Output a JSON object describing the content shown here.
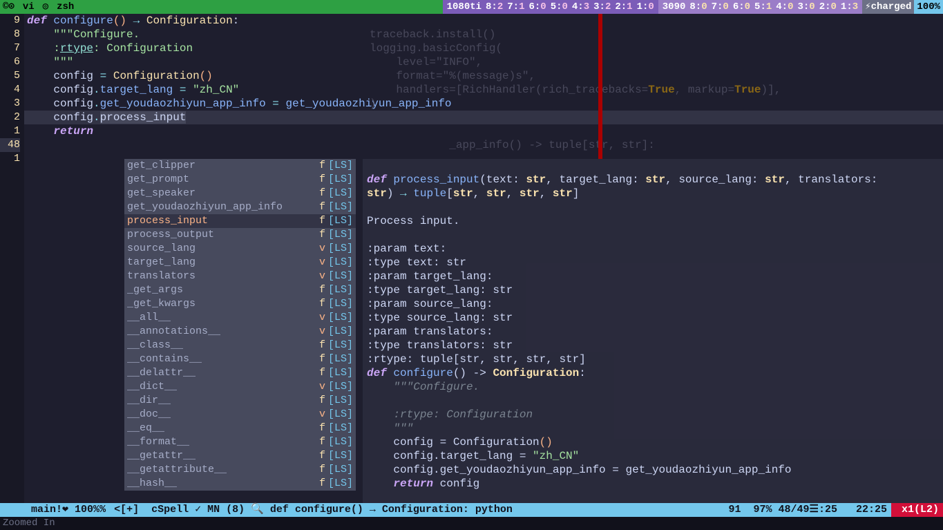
{
  "topbar": {
    "tabs": [
      "vi",
      "zsh"
    ],
    "gpu1_label": "1080ti",
    "gpu1_cores": [
      [
        "8:",
        "2"
      ],
      [
        "7:",
        "1"
      ],
      [
        "6:",
        "0"
      ],
      [
        "5:",
        "0"
      ],
      [
        "4:",
        "3"
      ],
      [
        "3:",
        "2"
      ],
      [
        "2:",
        "1"
      ],
      [
        "1:",
        "0"
      ]
    ],
    "gpu2_label": "3090",
    "gpu2_cores": [
      [
        "8:",
        "0"
      ],
      [
        "7:",
        "0"
      ],
      [
        "6:",
        "0"
      ],
      [
        "5:",
        "1"
      ],
      [
        "4:",
        "0"
      ],
      [
        "3:",
        "0"
      ],
      [
        "2:",
        "0"
      ],
      [
        "1:",
        "3"
      ]
    ],
    "charged": "charged",
    "battery": "100%"
  },
  "gutter": [
    "9",
    "8",
    "7",
    "6",
    "5",
    "4",
    "3",
    "2",
    "1",
    "48",
    "1"
  ],
  "code": {
    "l1": "",
    "l2_def": "def ",
    "l2_fn": "configure",
    "l2_par": "()",
    "l2_arrow": " → ",
    "l2_ret": "Configuration",
    "l2_colon": ":",
    "l3": "    \"\"\"Configure.",
    "l4": "",
    "l5_a": "    :",
    "l5_r": "rtype",
    "l5_b": ": Configuration",
    "l6": "    \"\"\"",
    "l7_a": "    config ",
    "l7_eq": "=",
    "l7_b": " ",
    "l7_cls": "Configuration",
    "l7_par": "()",
    "l8_a": "    config",
    "l8_dot": ".",
    "l8_attr": "target_lang",
    "l8_b": " = ",
    "l8_str": "\"zh_CN\"",
    "l9_a": "    config",
    "l9_dot": ".",
    "l9_attr": "get_youdaozhiyun_app_info",
    "l9_b": " = ",
    "l9_fn": "get_youdaozhiyun_app_info",
    "l10_a": "    config",
    "l10_dot": ".",
    "l10_attr": "process_input",
    "l11": "    return"
  },
  "bg_code": [
    "traceback.install()",
    "logging.basicConfig(",
    "    level=\"INFO\",",
    "    format=\"%(message)s\",",
    "    handlers=[RichHandler(rich_tracebacks=True, markup=True)],",
    ")",
    "",
    "",
    "            _app_info() -> tuple[str, str]:"
  ],
  "popup": [
    {
      "name": "get_clipper",
      "kind": "f",
      "src": "[LS]"
    },
    {
      "name": "get_prompt",
      "kind": "f",
      "src": "[LS]"
    },
    {
      "name": "get_speaker",
      "kind": "f",
      "src": "[LS]"
    },
    {
      "name": "get_youdaozhiyun_app_info",
      "kind": "f",
      "src": "[LS]"
    },
    {
      "name": "process_input",
      "kind": "f",
      "src": "[LS]",
      "selected": true
    },
    {
      "name": "process_output",
      "kind": "f",
      "src": "[LS]"
    },
    {
      "name": "source_lang",
      "kind": "v",
      "src": "[LS]"
    },
    {
      "name": "target_lang",
      "kind": "v",
      "src": "[LS]"
    },
    {
      "name": "translators",
      "kind": "v",
      "src": "[LS]"
    },
    {
      "name": "_get_args",
      "kind": "f",
      "src": "[LS]"
    },
    {
      "name": "_get_kwargs",
      "kind": "f",
      "src": "[LS]"
    },
    {
      "name": "__all__",
      "kind": "v",
      "src": "[LS]"
    },
    {
      "name": "__annotations__",
      "kind": "v",
      "src": "[LS]"
    },
    {
      "name": "__class__",
      "kind": "f",
      "src": "[LS]"
    },
    {
      "name": "__contains__",
      "kind": "f",
      "src": "[LS]"
    },
    {
      "name": "__delattr__",
      "kind": "f",
      "src": "[LS]"
    },
    {
      "name": "__dict__",
      "kind": "v",
      "src": "[LS]"
    },
    {
      "name": "__dir__",
      "kind": "f",
      "src": "[LS]"
    },
    {
      "name": "__doc__",
      "kind": "v",
      "src": "[LS]"
    },
    {
      "name": "__eq__",
      "kind": "f",
      "src": "[LS]"
    },
    {
      "name": "__format__",
      "kind": "f",
      "src": "[LS]"
    },
    {
      "name": "__getattr__",
      "kind": "f",
      "src": "[LS]"
    },
    {
      "name": "__getattribute__",
      "kind": "f",
      "src": "[LS]"
    },
    {
      "name": "__hash__",
      "kind": "f",
      "src": "[LS]"
    }
  ],
  "doc": {
    "sig1": "def process_input(text: str, target_lang: str, source_lang: str, translators:",
    "sig2": "str) → tuple[str, str, str, str]",
    "desc": "Process input.",
    "params": [
      ":param text:",
      ":type text: str",
      ":param target_lang:",
      ":type target_lang: str",
      ":param source_lang:",
      ":type source_lang: str",
      ":param translators:",
      ":type translators: str",
      ":rtype: tuple[str, str, str, str]"
    ],
    "cfg_def": "def configure() -> Configuration:",
    "cfg_lines": [
      "    \"\"\"Configure.",
      "",
      "    :rtype: Configuration",
      "    \"\"\"",
      "    config = Configuration()",
      "    config.target_lang = \"zh_CN\"",
      "    config.get_youdaozhiyun_app_info = get_youdaozhiyun_app_info",
      "    return config"
    ]
  },
  "statusbar": {
    "mode": "  ",
    "branch": " main!❤ 100%%",
    "file": "<[+]  cSpell ✓ MN (8) 🔍 def configure() → Configuration: python ",
    "pos": "91  97% 48/49☰:25   22:25",
    "warn": " x1(L2)"
  },
  "zoom": "Zoomed In"
}
